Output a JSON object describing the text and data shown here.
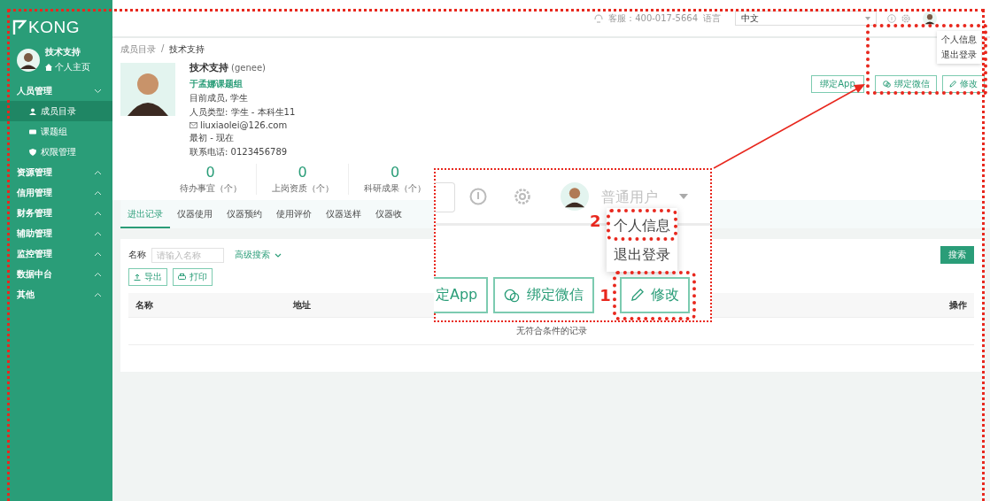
{
  "sidebar": {
    "logo": "KONG",
    "user_name": "技术支持",
    "home_link": "个人主页",
    "menu": [
      {
        "label": "人员管理",
        "expanded": true,
        "children": [
          {
            "label": "成员目录",
            "selected": true
          },
          {
            "label": "课题组",
            "selected": false
          },
          {
            "label": "权限管理",
            "selected": false
          }
        ]
      },
      {
        "label": "资源管理",
        "expanded": false
      },
      {
        "label": "信用管理",
        "expanded": false
      },
      {
        "label": "财务管理",
        "expanded": false
      },
      {
        "label": "辅助管理",
        "expanded": false
      },
      {
        "label": "监控管理",
        "expanded": false
      },
      {
        "label": "数据中台",
        "expanded": false
      },
      {
        "label": "其他",
        "expanded": false
      }
    ]
  },
  "header": {
    "service": "客服：400-017-5664",
    "language_label": "语言",
    "language": "中文",
    "user_menu": [
      "个人信息",
      "退出登录"
    ]
  },
  "breadcrumb": {
    "items": [
      "成员目录",
      "技术支持"
    ],
    "separator": "/"
  },
  "profile": {
    "name": "技术支持",
    "account": "(genee)",
    "group": "于孟娜课题组",
    "lines": [
      "目前成员, 学生",
      "人员类型: 学生 - 本科生11"
    ],
    "email": "liuxiaolei@126.com",
    "period": "最初 - 现在",
    "phone": "联系电话: 0123456789"
  },
  "actions": [
    "绑定App",
    "绑定微信",
    "修改"
  ],
  "stats": [
    {
      "value": "0",
      "label": "待办事宜（个）"
    },
    {
      "value": "0",
      "label": "上岗资质（个）"
    },
    {
      "value": "0",
      "label": "科研成果（个）"
    }
  ],
  "tabs": [
    {
      "label": "进出记录",
      "selected": true
    },
    {
      "label": "仪器使用",
      "selected": false
    },
    {
      "label": "仪器预约",
      "selected": false
    },
    {
      "label": "使用评价",
      "selected": false
    },
    {
      "label": "仪器送样",
      "selected": false
    },
    {
      "label": "仪器收",
      "selected": false
    }
  ],
  "filter": {
    "label": "名称",
    "placeholder": "请输入名称",
    "advanced": "高级搜索",
    "search": "搜索",
    "tools": [
      "导出",
      "打印"
    ]
  },
  "table": {
    "columns": [
      "名称",
      "地址",
      "操作"
    ],
    "empty": "无符合条件的记录"
  },
  "callout": {
    "user_name": "普通用户",
    "menu": [
      "个人信息",
      "退出登录"
    ],
    "buttons": [
      "定App",
      "绑定微信",
      "修改"
    ],
    "steps": [
      "2",
      "1"
    ]
  }
}
